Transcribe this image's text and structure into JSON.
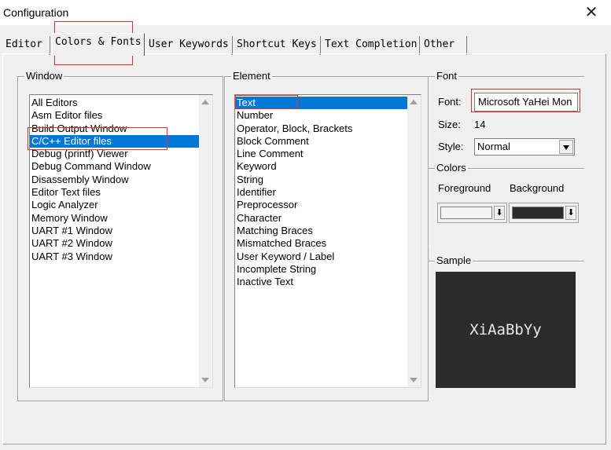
{
  "window": {
    "title": "Configuration",
    "close_glyph": "✕"
  },
  "tabs": [
    {
      "label": "Editor"
    },
    {
      "label": "Colors & Fonts",
      "active": true
    },
    {
      "label": "User Keywords"
    },
    {
      "label": "Shortcut Keys"
    },
    {
      "label": "Text Completion"
    },
    {
      "label": "Other"
    }
  ],
  "window_group": {
    "label": "Window",
    "items": [
      "All Editors",
      "Asm Editor files",
      "Build Output Window",
      "C/C++ Editor files",
      "Debug (printf) Viewer",
      "Debug Command Window",
      "Disassembly Window",
      "Editor Text files",
      "Logic Analyzer",
      "Memory Window",
      "UART #1 Window",
      "UART #2 Window",
      "UART #3 Window"
    ],
    "selected_index": 3
  },
  "element_group": {
    "label": "Element",
    "items": [
      "Text",
      "Number",
      "Operator, Block, Brackets",
      "Block Comment",
      "Line Comment",
      "Keyword",
      "String",
      "Identifier",
      "Preprocessor",
      "Character",
      "Matching Braces",
      "Mismatched Braces",
      "User Keyword / Label",
      "Incomplete String",
      "Inactive Text"
    ],
    "selected_index": 0
  },
  "font_group": {
    "label": "Font",
    "font_label": "Font:",
    "font_value": "Microsoft YaHei Mon",
    "size_label": "Size:",
    "size_value": "14",
    "style_label": "Style:",
    "style_value": "Normal"
  },
  "colors_group": {
    "label": "Colors",
    "foreground_label": "Foreground",
    "background_label": "Background",
    "foreground_color": "#f4f4f4",
    "background_color": "#2b2b2b"
  },
  "sample_group": {
    "label": "Sample",
    "text": "XiAaBbYy"
  }
}
